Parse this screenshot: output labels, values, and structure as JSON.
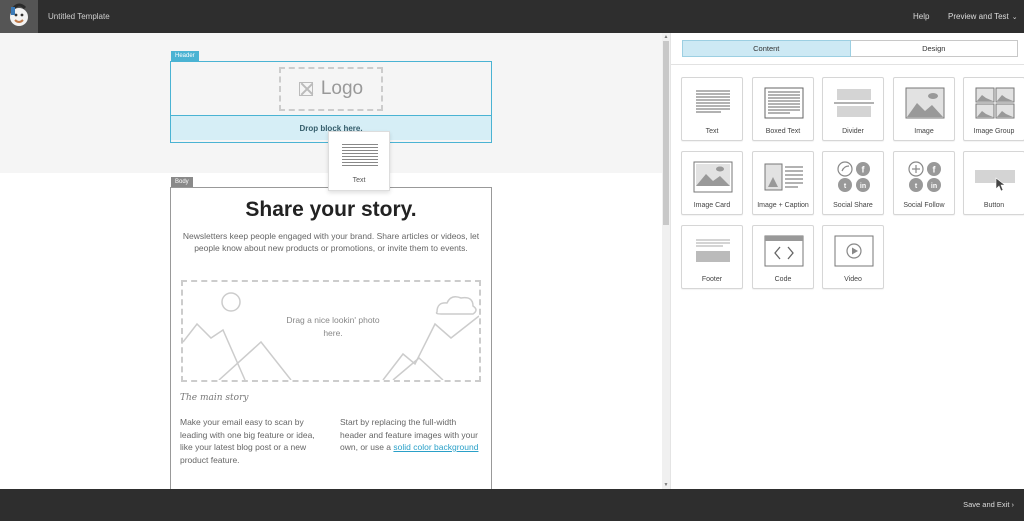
{
  "topbar": {
    "title": "Untitled Template",
    "help": "Help",
    "preview": "Preview and Test",
    "caret": "⌄"
  },
  "canvas": {
    "header_tag": "Header",
    "body_tag": "Body",
    "logo": "Logo",
    "drop_block": "Drop block here.",
    "drag_ghost_label": "Text",
    "hero_title": "Share your story.",
    "hero_sub": "Newsletters keep people engaged with your brand. Share articles or videos, let people know about new products or promotions, or invite them to events.",
    "photo_placeholder": "Drag a nice lookin' photo here.",
    "story_heading": "The main story",
    "col_left": "Make your email easy to scan by leading with one big feature or idea, like your latest blog post or a new product feature.",
    "col_right_text": "Start by replacing the full-width header and feature images with your own, or use a",
    "col_right_link": "solid color background"
  },
  "panel": {
    "tabs": [
      {
        "label": "Content",
        "active": true
      },
      {
        "label": "Design",
        "active": false
      }
    ],
    "blocks": [
      {
        "label": "Text",
        "icon": "text-block-icon"
      },
      {
        "label": "Boxed Text",
        "icon": "boxed-text-block-icon"
      },
      {
        "label": "Divider",
        "icon": "divider-block-icon"
      },
      {
        "label": "Image",
        "icon": "image-block-icon"
      },
      {
        "label": "Image Group",
        "icon": "image-group-block-icon"
      },
      {
        "label": "Image Card",
        "icon": "image-card-block-icon"
      },
      {
        "label": "Image + Caption",
        "icon": "image-caption-block-icon"
      },
      {
        "label": "Social Share",
        "icon": "social-share-block-icon"
      },
      {
        "label": "Social Follow",
        "icon": "social-follow-block-icon"
      },
      {
        "label": "Button",
        "icon": "button-block-icon"
      },
      {
        "label": "Footer",
        "icon": "footer-block-icon"
      },
      {
        "label": "Code",
        "icon": "code-block-icon"
      },
      {
        "label": "Video",
        "icon": "video-block-icon"
      }
    ]
  },
  "bottombar": {
    "save_exit": "Save and Exit",
    "chevron": "›"
  },
  "colors": {
    "accent": "#4ab3d3",
    "tab_active": "#cde9f4",
    "bar": "#2e2e2e",
    "link": "#2aa0c8"
  }
}
